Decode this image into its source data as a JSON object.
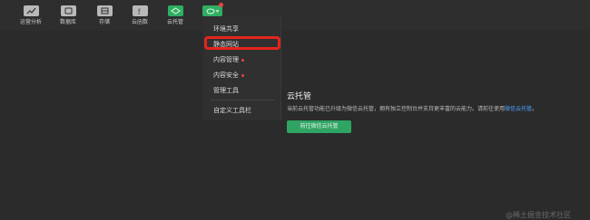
{
  "toolbar": {
    "items": [
      {
        "label": "运营分析",
        "icon": "analytics-icon"
      },
      {
        "label": "数据库",
        "icon": "database-icon"
      },
      {
        "label": "存储",
        "icon": "storage-icon"
      },
      {
        "label": "云函数",
        "icon": "function-icon"
      },
      {
        "label": "云托管",
        "icon": "cloud-hosting-icon"
      },
      {
        "icon": "cloud-more-icon"
      }
    ],
    "accent": "#2fae62"
  },
  "menu": {
    "items": [
      {
        "label": "环境共享"
      },
      {
        "label": "静态网站"
      },
      {
        "label": "内容管理"
      },
      {
        "label": "内容安全"
      },
      {
        "label": "管理工具"
      },
      {
        "label": "自定义工具栏"
      }
    ]
  },
  "main": {
    "title": "云托管",
    "description": "当前云托管功能已升级为微信云托管，拥有独立控制台并支持更丰富的云能力。请前往使用",
    "description_link": "微信云托管",
    "description_end": "。",
    "button_label": "前往微信云托管"
  },
  "watermark": "@稀土掘金技术社区",
  "colors": {
    "highlight": "#e5251c",
    "link": "#4da3ff",
    "badge": "#e64340"
  }
}
